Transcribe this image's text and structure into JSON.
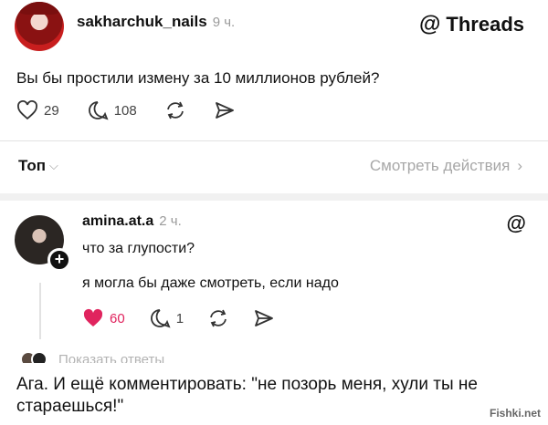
{
  "post": {
    "username": "sakharchuk_nails",
    "time": "9 ч.",
    "text": "Вы бы простили измену за 10 миллионов рублей?",
    "likes": "29",
    "comments": "108"
  },
  "brand": {
    "label": "Threads",
    "icon": "threads-icon"
  },
  "sort": {
    "label": "Топ",
    "view_activity": "Смотреть действия"
  },
  "reply": {
    "username": "amina.at.a",
    "time": "2 ч.",
    "line1": "что за глупости?",
    "line2": "я могла бы даже смотреть, если надо",
    "likes": "60",
    "comments": "1"
  },
  "show_replies": "Показать ответы",
  "caption": "Ага. И ещё комментировать: \"не позорь меня, хули ты не стараешься!\"",
  "watermark": "Fishki.net",
  "colors": {
    "like_active": "#e0245e",
    "muted": "#a7a7a7"
  }
}
